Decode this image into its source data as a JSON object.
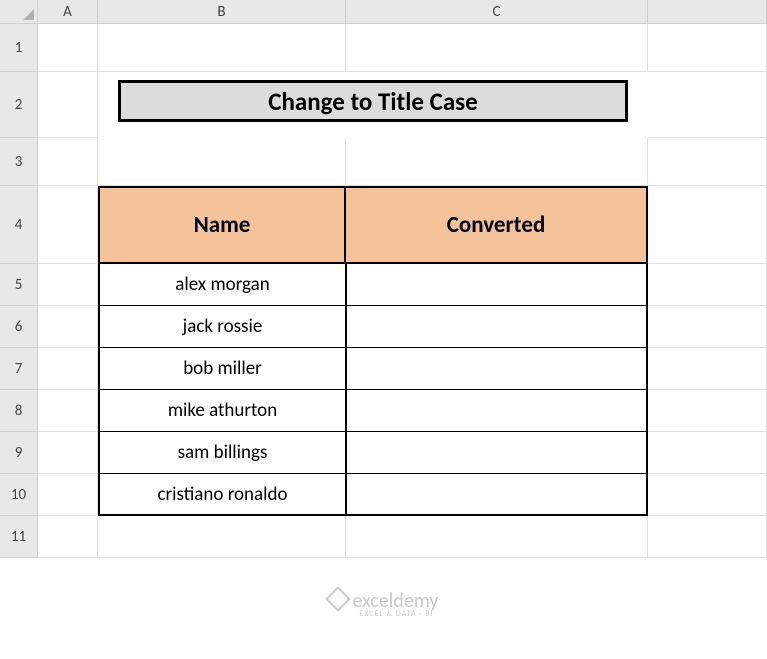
{
  "columns": [
    "A",
    "B",
    "C"
  ],
  "rows": [
    "1",
    "2",
    "3",
    "4",
    "5",
    "6",
    "7",
    "8",
    "9",
    "10",
    "11"
  ],
  "title": "Change to Title Case",
  "table": {
    "headers": {
      "name": "Name",
      "converted": "Converted"
    },
    "data": [
      {
        "name": "alex morgan",
        "converted": ""
      },
      {
        "name": "jack rossie",
        "converted": ""
      },
      {
        "name": "bob miller",
        "converted": ""
      },
      {
        "name": "mike athurton",
        "converted": ""
      },
      {
        "name": "sam billings",
        "converted": ""
      },
      {
        "name": "cristiano ronaldo",
        "converted": ""
      }
    ]
  },
  "watermark": {
    "main": "exceldemy",
    "sub": "EXCEL & DATA · BI"
  }
}
